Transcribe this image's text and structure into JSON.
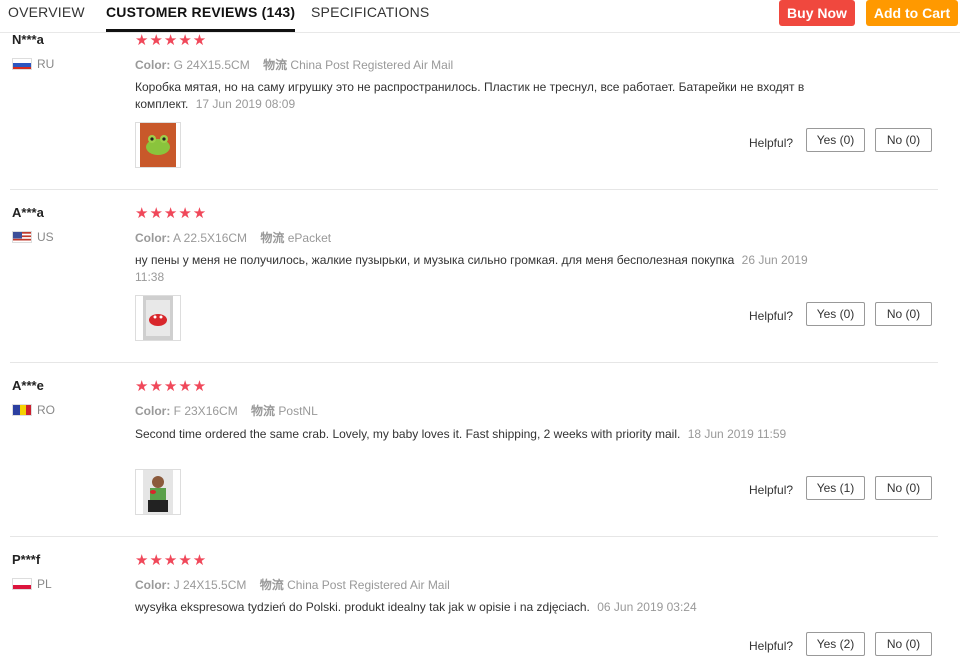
{
  "tabs": [
    {
      "label": "OVERVIEW"
    },
    {
      "label": "CUSTOMER REVIEWS (143)"
    },
    {
      "label": "SPECIFICATIONS"
    }
  ],
  "actions": {
    "buy_now": "Buy Now",
    "add_to_cart": "Add to Cart"
  },
  "helpful_label": "Helpful?",
  "reviews": [
    {
      "user": "N***a",
      "country": "RU",
      "stars": "★★★★★",
      "rating": 5,
      "color_label": "Color:",
      "color": "G 24X15.5CM",
      "shipping_label": "物流",
      "shipping": "China Post Registered Air Mail",
      "text": "Коробка мятая, но на саму игрушку это не распространилось. Пластик не треснул, все работает. Батарейки не входят в комплект.",
      "date": "17 Jun 2019 08:09",
      "yes": "Yes (0)",
      "no": "No (0)"
    },
    {
      "user": "A***a",
      "country": "US",
      "stars": "★★★★★",
      "rating": 5,
      "color_label": "Color:",
      "color": "A 22.5X16CM",
      "shipping_label": "物流",
      "shipping": "ePacket",
      "text": "ну пены у меня не получилось, жалкие пузырьки, и музыка сильно громкая. для меня бесполезная покупка",
      "date": "26 Jun 2019 11:38",
      "yes": "Yes (0)",
      "no": "No (0)"
    },
    {
      "user": "A***e",
      "country": "RO",
      "stars": "★★★★★",
      "rating": 5,
      "color_label": "Color:",
      "color": "F 23X16CM",
      "shipping_label": "物流",
      "shipping": "PostNL",
      "text": "Second time ordered the same crab. Lovely, my baby loves it. Fast shipping, 2 weeks with priority mail.",
      "date": "18 Jun 2019 11:59",
      "yes": "Yes (1)",
      "no": "No (0)"
    },
    {
      "user": "P***f",
      "country": "PL",
      "stars": "★★★★★",
      "rating": 5,
      "color_label": "Color:",
      "color": "J 24X15.5CM",
      "shipping_label": "物流",
      "shipping": "China Post Registered Air Mail",
      "text": "wysyłka ekspresowa tydzień do Polski. produkt idealny tak jak w opisie i na zdjęciach.",
      "date": "06 Jun 2019 03:24",
      "yes": "Yes (2)",
      "no": "No (0)"
    }
  ]
}
